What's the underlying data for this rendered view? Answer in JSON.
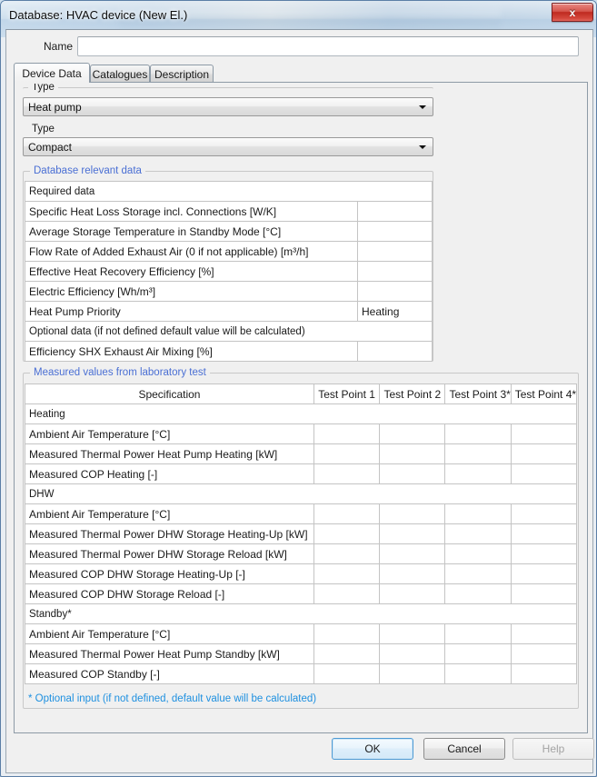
{
  "window": {
    "title": "Database: HVAC device (New El.)",
    "close_label": "x"
  },
  "name_field": {
    "label": "Name",
    "value": "",
    "placeholder": ""
  },
  "tabs": [
    {
      "label": "Device Data",
      "active": true
    },
    {
      "label": "Catalogues",
      "active": false
    },
    {
      "label": "Description",
      "active": false
    }
  ],
  "type_section": {
    "label_1": "Type",
    "value_1": "Heat pump",
    "label_2": "Type",
    "value_2": "Compact"
  },
  "database_group": {
    "legend": "Database relevant data",
    "required_header": "Required data",
    "optional_header": "Optional data (if not defined default value will be calculated)",
    "required_rows": [
      {
        "label": "Specific Heat Loss Storage incl. Connections  [W/K]",
        "value": ""
      },
      {
        "label": "Average Storage Temperature in Standby Mode  [°C]",
        "value": ""
      },
      {
        "label": "Flow Rate of Added Exhaust Air (0 if not applicable)  [m³/h]",
        "value": ""
      },
      {
        "label": "Effective Heat Recovery Efficiency  [%]",
        "value": ""
      },
      {
        "label": "Electric Efficiency  [Wh/m³]",
        "value": ""
      },
      {
        "label": "Heat Pump Priority",
        "value": "Heating"
      }
    ],
    "optional_rows": [
      {
        "label": "Efficiency SHX Exhaust Air Mixing  [%]",
        "value": ""
      }
    ]
  },
  "measured_group": {
    "legend": "Measured values from laboratory test",
    "columns": [
      "Specification",
      "Test Point 1",
      "Test Point 2",
      "Test Point 3*",
      "Test Point 4*"
    ],
    "sections": [
      {
        "title": "Heating",
        "rows": [
          {
            "label": "Ambient Air Temperature [°C]",
            "values": [
              "",
              "",
              "",
              ""
            ]
          },
          {
            "label": "Measured Thermal Power Heat Pump Heating [kW]",
            "values": [
              "",
              "",
              "",
              ""
            ]
          },
          {
            "label": "Measured COP Heating [-]",
            "values": [
              "",
              "",
              "",
              ""
            ]
          }
        ]
      },
      {
        "title": "DHW",
        "rows": [
          {
            "label": "Ambient Air Temperature [°C]",
            "values": [
              "",
              "",
              "",
              ""
            ]
          },
          {
            "label": "Measured Thermal Power DHW Storage Heating-Up [kW]",
            "values": [
              "",
              "",
              "",
              ""
            ]
          },
          {
            "label": "Measured Thermal Power DHW Storage Reload [kW]",
            "values": [
              "",
              "",
              "",
              ""
            ]
          },
          {
            "label": "Measured COP DHW Storage Heating-Up [-]",
            "values": [
              "",
              "",
              "",
              ""
            ]
          },
          {
            "label": "Measured COP DHW Storage Reload [-]",
            "values": [
              "",
              "",
              "",
              ""
            ]
          }
        ]
      },
      {
        "title": "Standby*",
        "rows": [
          {
            "label": "Ambient Air Temperature [°C]",
            "values": [
              "",
              "",
              "",
              ""
            ]
          },
          {
            "label": "Measured Thermal Power Heat Pump Standby [kW]",
            "values": [
              "",
              "",
              "",
              ""
            ]
          },
          {
            "label": "Measured COP Standby [-]",
            "values": [
              "",
              "",
              "",
              ""
            ]
          }
        ]
      }
    ],
    "footnote": "* Optional input (if not defined, default value will be calculated)"
  },
  "buttons": {
    "ok": "OK",
    "cancel": "Cancel",
    "help": "Help"
  },
  "colors": {
    "accent_blue": "#4a6fd4",
    "footnote_blue": "#1e90e0",
    "close_red": "#bf2a20",
    "default_button_border": "#4e9bd4"
  }
}
